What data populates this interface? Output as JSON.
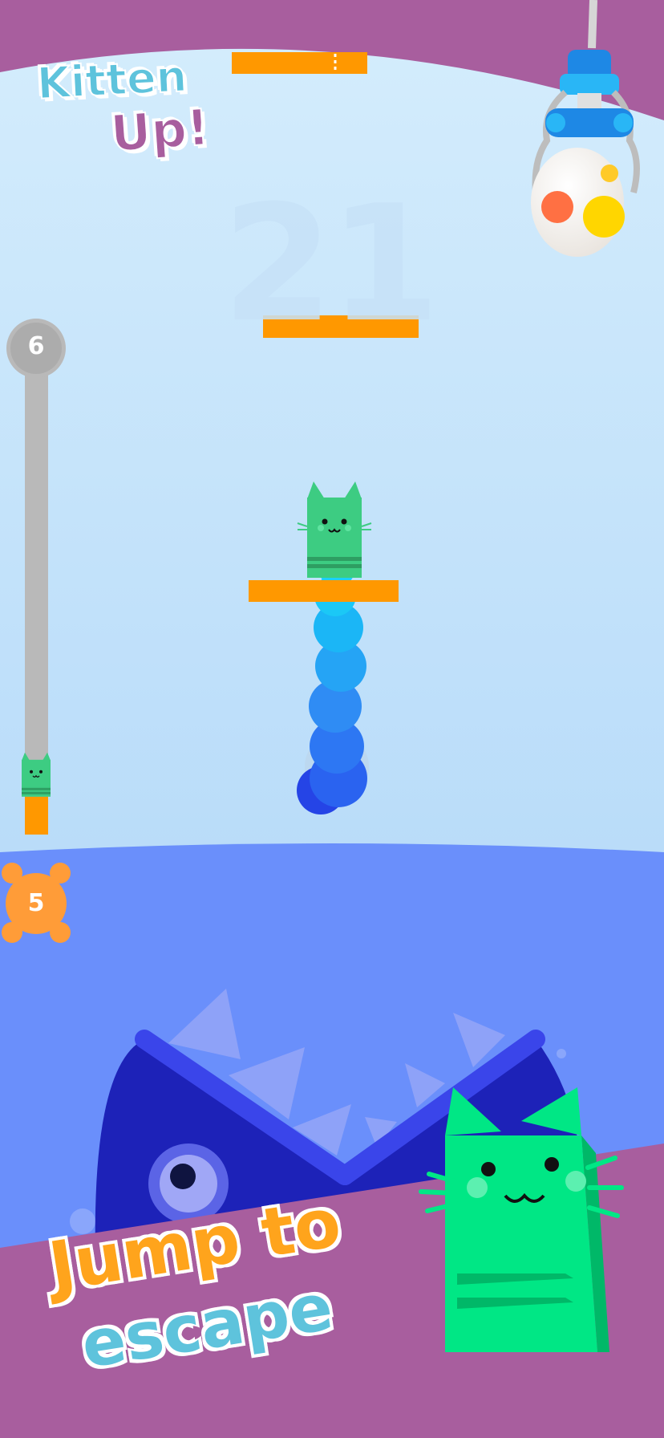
{
  "logo": {
    "line1": "Kitten",
    "line2": "Up!"
  },
  "score": "21",
  "progress": {
    "current_level": "5",
    "next_level": "6",
    "fraction": 0.08
  },
  "top_progress_bar": {
    "fill_fraction": 0.74
  },
  "tagline": {
    "line1": "Jump to",
    "line2": "escape"
  },
  "colors": {
    "frame": "#a85e9e",
    "sky": "#cde8fb",
    "water": "#6a8ffb",
    "platform": "#ff9800",
    "cat": "#3dcc82",
    "shark": "#1d22b8",
    "tagline_orange": "#ffa41c",
    "tagline_blue": "#5ec3dc"
  },
  "icons": [
    "claw-machine-icon",
    "egg-icon",
    "cat-icon",
    "shark-icon",
    "skull-icon"
  ]
}
